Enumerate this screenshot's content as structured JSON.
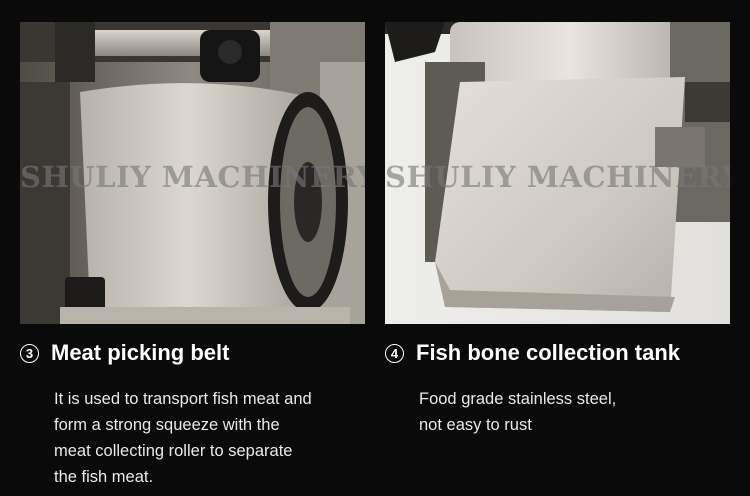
{
  "cards": [
    {
      "number": "3",
      "title": "Meat picking belt",
      "watermark": "SHULIY MACHINERY",
      "description": [
        "It is used to transport fish meat and",
        "form a strong squeeze with the",
        "meat collecting roller to separate",
        "the fish meat."
      ]
    },
    {
      "number": "4",
      "title": "Fish bone collection tank",
      "watermark": "SHULIY MACHINERY",
      "description": [
        "Food grade stainless steel,",
        "not easy to rust"
      ]
    }
  ],
  "colors": {
    "background": "#0a0a0a",
    "text": "#ffffff",
    "steel": "#c8c4bc"
  }
}
